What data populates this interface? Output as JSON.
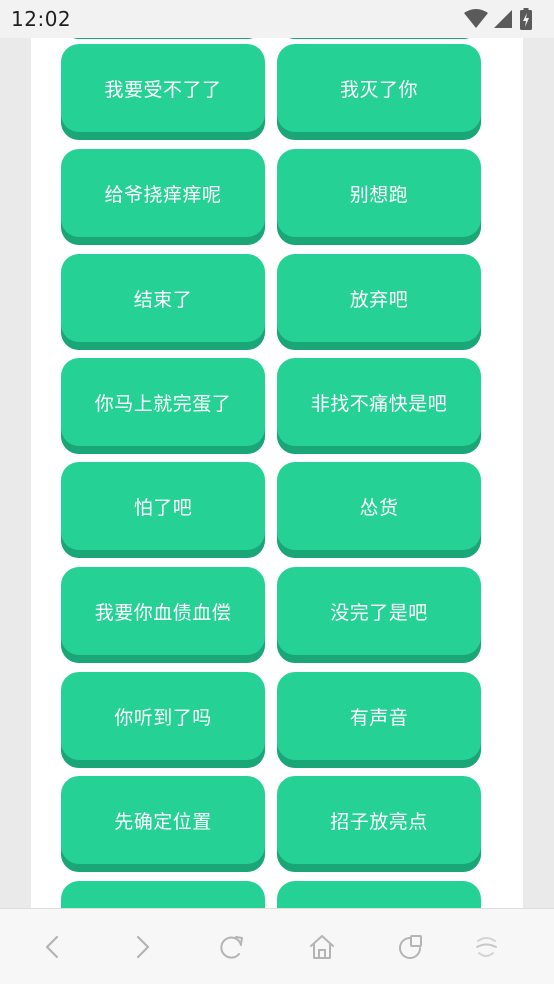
{
  "status_bar": {
    "time": "12:02"
  },
  "sound_buttons": [
    {
      "label": ""
    },
    {
      "label": ""
    },
    {
      "label": "我要受不了了"
    },
    {
      "label": "我灭了你"
    },
    {
      "label": "给爷挠痒痒呢"
    },
    {
      "label": "别想跑"
    },
    {
      "label": "结束了"
    },
    {
      "label": "放弃吧"
    },
    {
      "label": "你马上就完蛋了"
    },
    {
      "label": "非找不痛快是吧"
    },
    {
      "label": "怕了吧"
    },
    {
      "label": "怂货"
    },
    {
      "label": "我要你血债血偿"
    },
    {
      "label": "没完了是吧"
    },
    {
      "label": "你听到了吗"
    },
    {
      "label": "有声音"
    },
    {
      "label": "先确定位置"
    },
    {
      "label": "招子放亮点"
    },
    {
      "label": ""
    },
    {
      "label": ""
    }
  ],
  "colors": {
    "button": "#26d196",
    "button_shadow": "#1aa677",
    "page_background": "#eaeaea"
  },
  "nav_icons": [
    "back-icon",
    "forward-icon",
    "refresh-icon",
    "home-icon",
    "tabs-icon",
    "menu-icon"
  ]
}
